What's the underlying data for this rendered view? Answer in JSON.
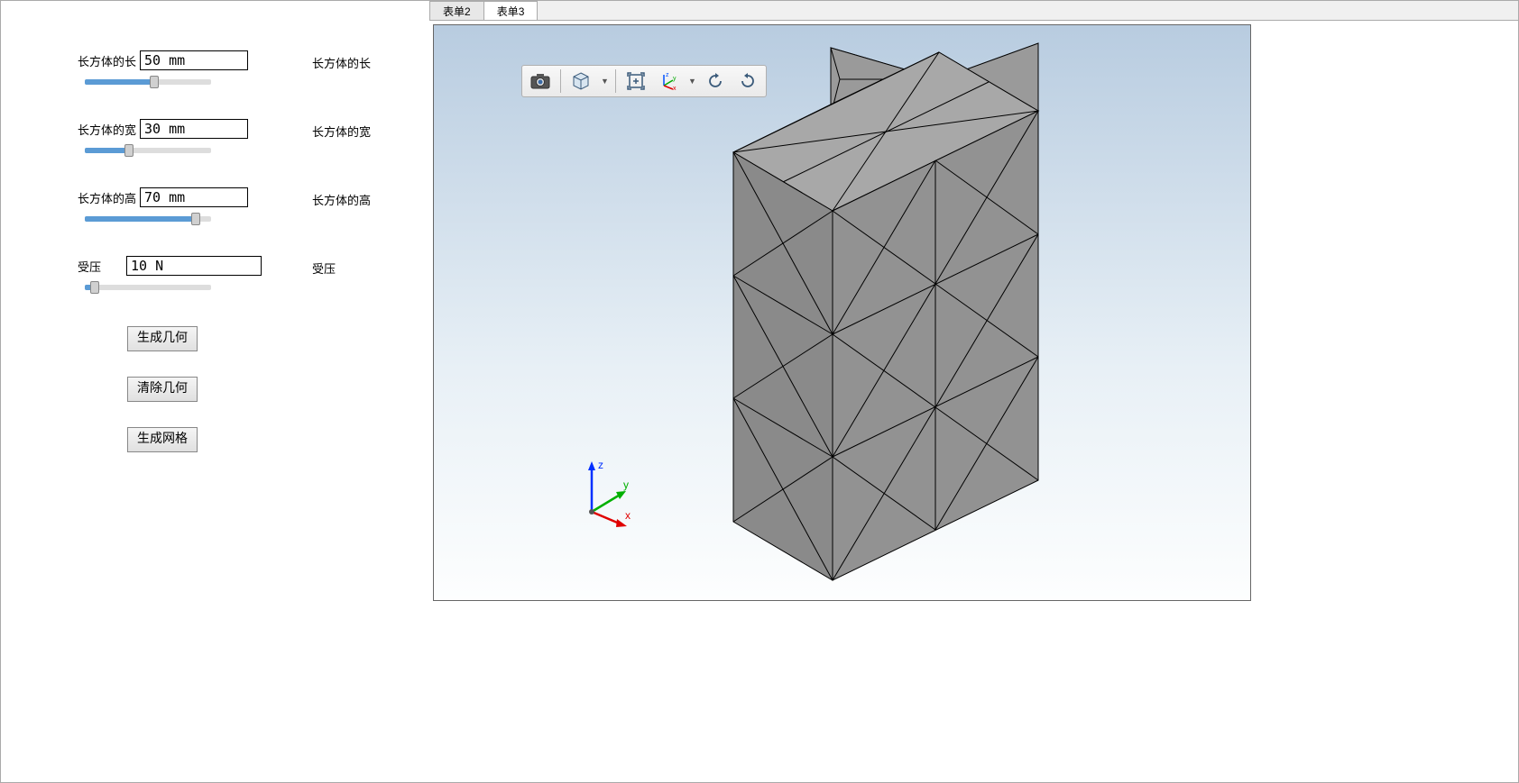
{
  "params": {
    "length": {
      "label": "长方体的长",
      "value": "50 mm",
      "right_label": "长方体的长",
      "slider_pct": 55
    },
    "width": {
      "label": "长方体的宽",
      "value": "30 mm",
      "right_label": "长方体的宽",
      "slider_pct": 35
    },
    "height": {
      "label": "长方体的高",
      "value": "70 mm",
      "right_label": "长方体的高",
      "slider_pct": 88
    },
    "pressure": {
      "label": "受压",
      "value": "10 N",
      "right_label": "受压",
      "slider_pct": 8
    }
  },
  "buttons": {
    "generate_geometry": "生成几何",
    "clear_geometry": "清除几何",
    "generate_mesh": "生成网格"
  },
  "tabs": {
    "tab2": "表单2",
    "tab3": "表单3",
    "active": "tab3"
  },
  "toolbar": {
    "snapshot_icon": "camera",
    "view_icon": "cube-view",
    "zoom_extents_icon": "zoom-extents",
    "axis_icon": "axis-triad",
    "rotate_left_icon": "rotate-ccw",
    "rotate_right_icon": "rotate-cw"
  },
  "axis_labels": {
    "x": "x",
    "y": "y",
    "z": "z"
  },
  "colors": {
    "slider_fill": "#5b9bd5",
    "viewport_gradient_top": "#b8cce0",
    "viewport_gradient_bottom": "#fdfefe",
    "mesh_fill": "#8a8a8a"
  }
}
